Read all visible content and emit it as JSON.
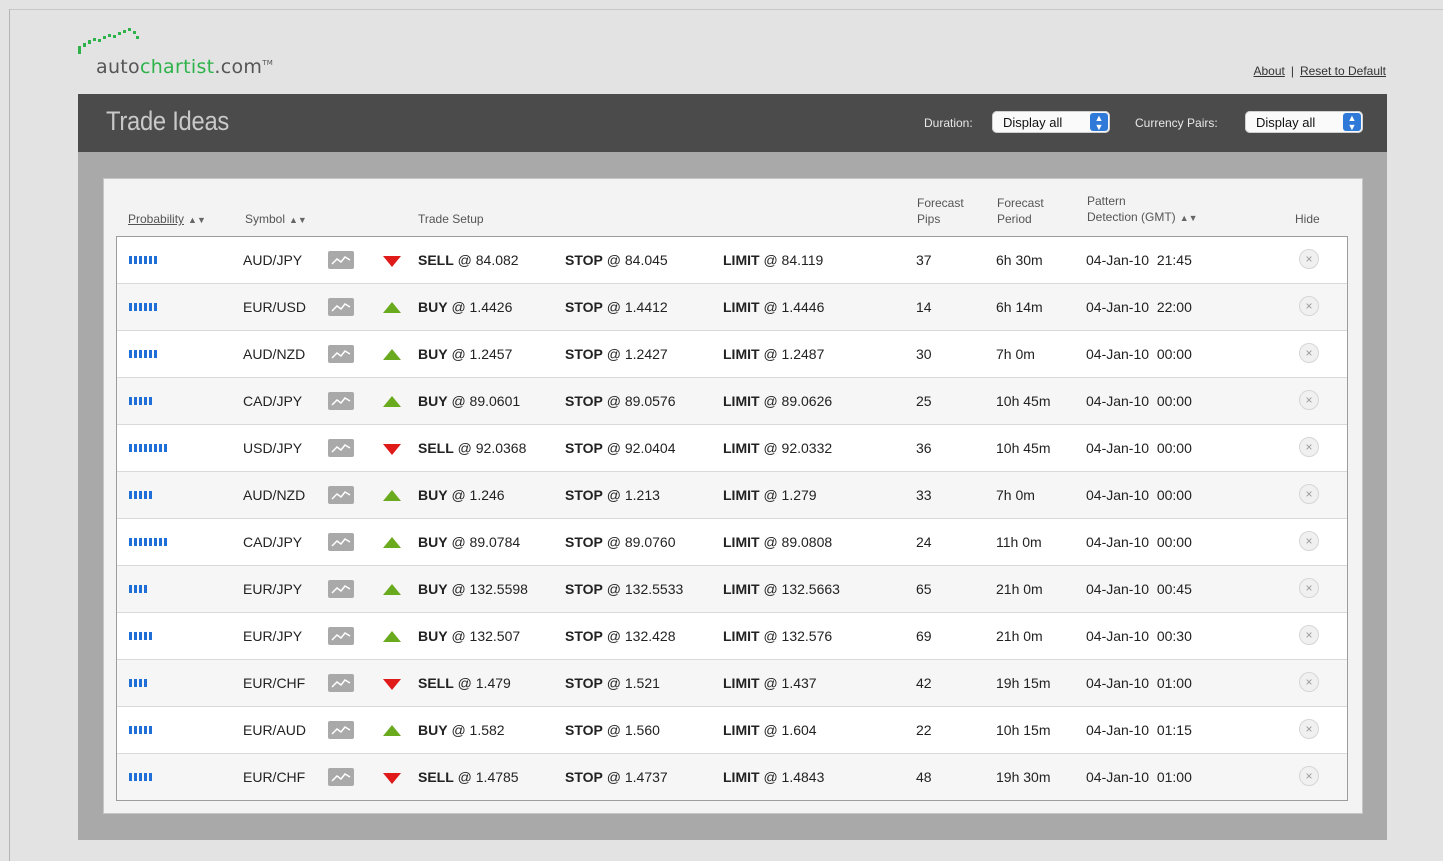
{
  "brand": {
    "logo_main": "auto",
    "logo_accent": "chartist",
    "logo_suffix": ".com",
    "logo_tm": "TM",
    "accent_color": "#2db34a"
  },
  "top_links": {
    "about": "About",
    "separator": "|",
    "reset": "Reset to Default"
  },
  "page": {
    "title": "Trade Ideas",
    "duration_label": "Duration:",
    "duration_value": "Display all",
    "pairs_label": "Currency Pairs:",
    "pairs_value": "Display all"
  },
  "columns": {
    "probability": "Probability",
    "symbol": "Symbol",
    "trade_setup": "Trade Setup",
    "forecast_pips_1": "Forecast",
    "forecast_pips_2": "Pips",
    "forecast_period_1": "Forecast",
    "forecast_period_2": "Period",
    "pattern_1": "Pattern",
    "pattern_2": "Detection (GMT)",
    "hide": "Hide"
  },
  "labels": {
    "stop": "STOP",
    "limit": "LIMIT",
    "hide_icon": "×"
  },
  "colors": {
    "probability_bar": "#1f6fd6",
    "buy": "#6aaa1e",
    "sell": "#e01919"
  },
  "rows": [
    {
      "prob": 6,
      "symbol": "AUD/JPY",
      "dir": "down",
      "action": "SELL",
      "price": "@ 84.082",
      "stop": "@ 84.045",
      "limit": "@ 84.119",
      "pips": "37",
      "period": "6h 30m",
      "date": "04-Jan-10  21:45"
    },
    {
      "prob": 6,
      "symbol": "EUR/USD",
      "dir": "up",
      "action": "BUY",
      "price": "@ 1.4426",
      "stop": "@ 1.4412",
      "limit": "@ 1.4446",
      "pips": "14",
      "period": "6h 14m",
      "date": "04-Jan-10  22:00"
    },
    {
      "prob": 6,
      "symbol": "AUD/NZD",
      "dir": "up",
      "action": "BUY",
      "price": "@ 1.2457",
      "stop": "@ 1.2427",
      "limit": "@ 1.2487",
      "pips": "30",
      "period": "7h 0m",
      "date": "04-Jan-10  00:00"
    },
    {
      "prob": 5,
      "symbol": "CAD/JPY",
      "dir": "up",
      "action": "BUY",
      "price": "@ 89.0601",
      "stop": "@ 89.0576",
      "limit": "@ 89.0626",
      "pips": "25",
      "period": "10h 45m",
      "date": "04-Jan-10  00:00"
    },
    {
      "prob": 8,
      "symbol": "USD/JPY",
      "dir": "down",
      "action": "SELL",
      "price": "@ 92.0368",
      "stop": "@ 92.0404",
      "limit": "@ 92.0332",
      "pips": "36",
      "period": "10h 45m",
      "date": "04-Jan-10  00:00"
    },
    {
      "prob": 5,
      "symbol": "AUD/NZD",
      "dir": "up",
      "action": "BUY",
      "price": "@ 1.246",
      "stop": "@ 1.213",
      "limit": "@ 1.279",
      "pips": "33",
      "period": "7h 0m",
      "date": "04-Jan-10  00:00"
    },
    {
      "prob": 8,
      "symbol": "CAD/JPY",
      "dir": "up",
      "action": "BUY",
      "price": "@ 89.0784",
      "stop": "@ 89.0760",
      "limit": "@ 89.0808",
      "pips": "24",
      "period": "11h 0m",
      "date": "04-Jan-10  00:00"
    },
    {
      "prob": 4,
      "symbol": "EUR/JPY",
      "dir": "up",
      "action": "BUY",
      "price": "@ 132.5598",
      "stop": "@ 132.5533",
      "limit": "@ 132.5663",
      "pips": "65",
      "period": "21h 0m",
      "date": "04-Jan-10  00:45"
    },
    {
      "prob": 5,
      "symbol": "EUR/JPY",
      "dir": "up",
      "action": "BUY",
      "price": "@ 132.507",
      "stop": "@ 132.428",
      "limit": "@ 132.576",
      "pips": "69",
      "period": "21h 0m",
      "date": "04-Jan-10  00:30"
    },
    {
      "prob": 4,
      "symbol": "EUR/CHF",
      "dir": "down",
      "action": "SELL",
      "price": "@ 1.479",
      "stop": "@ 1.521",
      "limit": "@ 1.437",
      "pips": "42",
      "period": "19h 15m",
      "date": "04-Jan-10  01:00"
    },
    {
      "prob": 5,
      "symbol": "EUR/AUD",
      "dir": "up",
      "action": "BUY",
      "price": "@ 1.582",
      "stop": "@ 1.560",
      "limit": "@ 1.604",
      "pips": "22",
      "period": "10h 15m",
      "date": "04-Jan-10  01:15"
    },
    {
      "prob": 5,
      "symbol": "EUR/CHF",
      "dir": "down",
      "action": "SELL",
      "price": "@ 1.4785",
      "stop": "@ 1.4737",
      "limit": "@ 1.4843",
      "pips": "48",
      "period": "19h 30m",
      "date": "04-Jan-10  01:00"
    }
  ]
}
